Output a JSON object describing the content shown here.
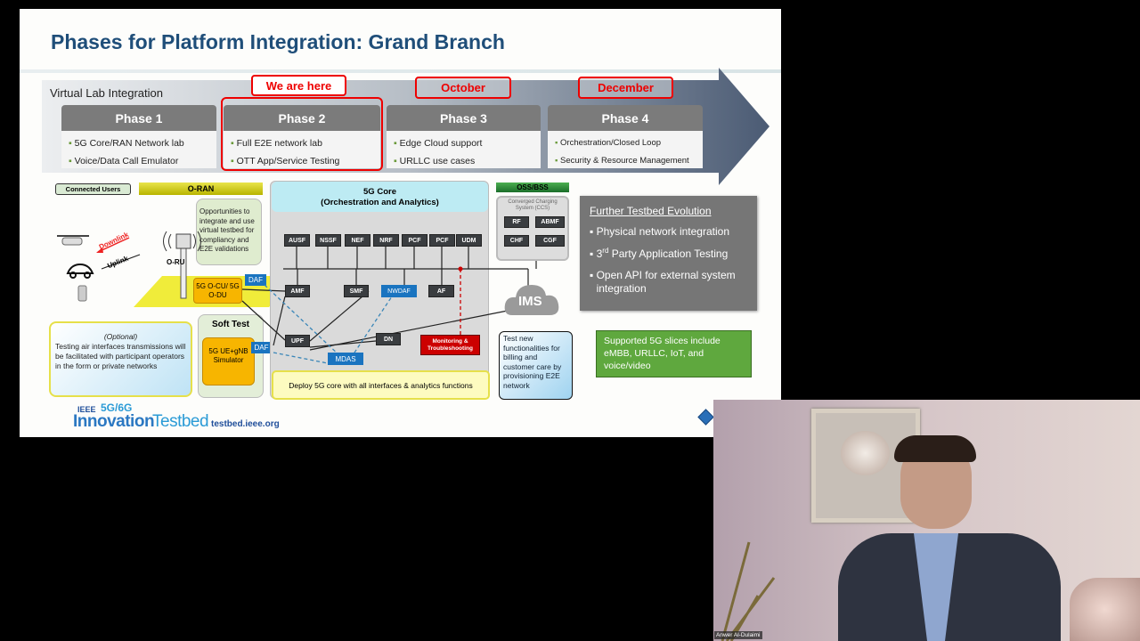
{
  "slide": {
    "title": "Phases for Platform Integration: Grand Branch",
    "section_label": "Virtual Lab Integration",
    "phases": [
      {
        "label": "Phase 1",
        "tag": "",
        "bullets": [
          "5G Core/RAN Network lab",
          "Voice/Data Call Emulator"
        ]
      },
      {
        "label": "Phase 2",
        "tag": "We are here",
        "bullets": [
          "Full E2E network lab",
          "OTT App/Service Testing"
        ]
      },
      {
        "label": "Phase 3",
        "tag": "October",
        "bullets": [
          "Edge Cloud support",
          "URLLC use cases"
        ]
      },
      {
        "label": "Phase 4",
        "tag": "December",
        "bullets": [
          "Orchestration/Closed Loop",
          "Security & Resource Management"
        ]
      }
    ],
    "diagram": {
      "connected_users": "Connected Users",
      "oran": "O-RAN",
      "downlink": "Downlink",
      "uplink": "Uplink",
      "oru": "O-RU",
      "opportunities": "Opportunities to integrate and use virtual testbed for compliancy and E2E validations",
      "ocu_odu": "5G O-CU/ 5G O-DU",
      "daf": "DAF",
      "optional_title": "(Optional)",
      "optional_text": "Testing air interfaces transmissions will be facilitated with participant operators in the form or private networks",
      "soft_test": "Soft Test",
      "simulator": "5G UE+gNB Simulator",
      "core_title": "5G Core",
      "core_subtitle": "(Orchestration and Analytics)",
      "nfs": [
        "AUSF",
        "NSSF",
        "NEF",
        "NRF",
        "PCF",
        "PCF",
        "UDM"
      ],
      "amf": "AMF",
      "smf": "SMF",
      "nwdaf": "NWDAF",
      "af": "AF",
      "upf": "UPF",
      "dn": "DN",
      "mdas": "MDAS",
      "monitoring": "Monitoring & Troubleshooting",
      "deploy": "Deploy 5G core with all interfaces & analytics functions",
      "oss_bss": "OSS/BSS",
      "ccs": "Converged Charging System (CCS)",
      "ccs_items": [
        "RF",
        "ABMF",
        "CHF",
        "CGF"
      ],
      "ims": "IMS",
      "test_new": "Test new functionalities for billing and customer care by provisioning E2E network"
    },
    "further": {
      "title": "Further Testbed Evolution",
      "items": [
        "Physical network integration",
        "3",
        "rd",
        " Party Application Testing",
        "Open API for external system integration"
      ]
    },
    "slices": "Supported 5G slices include eMBB, URLLC, IoT, and voice/video",
    "logo": {
      "ieee": "IEEE",
      "gen": "5G/6G",
      "name_a": "Innovation",
      "name_b": "Testbed",
      "url": "testbed.ieee.org"
    },
    "colors": {
      "title": "#1f4e79",
      "highlight": "#e00000",
      "oran": "#c8c400",
      "oss": "#2e8b3a",
      "nf_blue": "#1a74c0"
    }
  },
  "webcam": {
    "participant_name": "Anwer Al-Dulaimi"
  }
}
